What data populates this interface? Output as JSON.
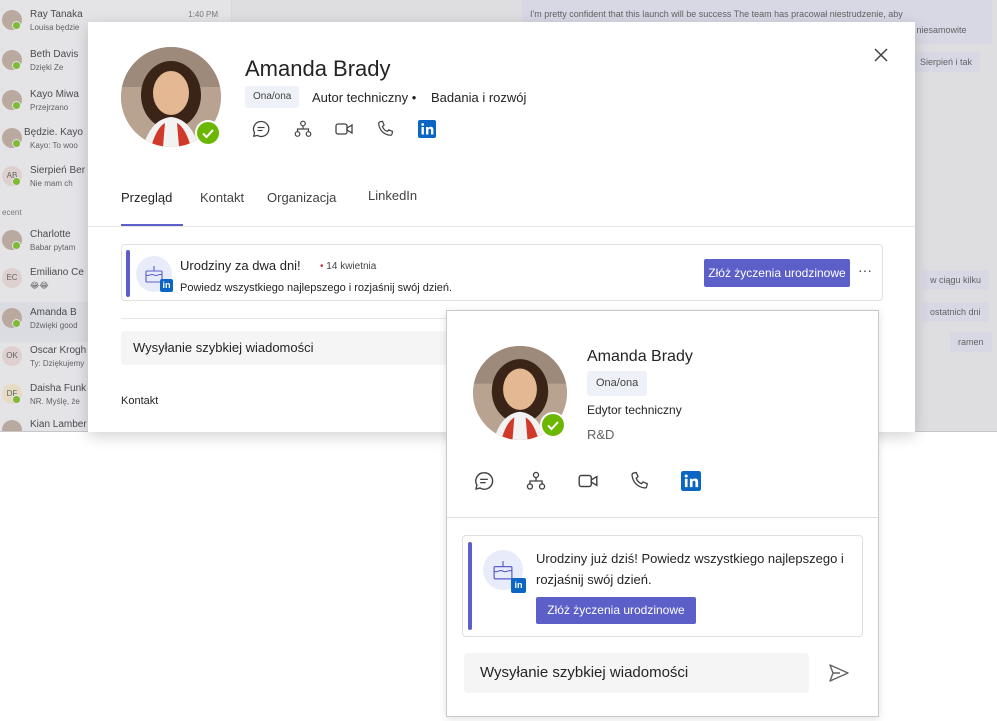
{
  "background": {
    "chat_list": [
      {
        "name": "Ray Tanaka",
        "preview": "Louisa będzie",
        "time": "1:40 PM",
        "avatar": ""
      },
      {
        "name": "Beth Davis",
        "preview": "Dzięki Ze",
        "time": "",
        "avatar": ""
      },
      {
        "name": "Kayo Miwa",
        "preview": "Przejrzano",
        "time": "",
        "avatar": ""
      },
      {
        "name": "Będzie. Kayo",
        "preview": "Kayo: To woo",
        "time": "",
        "avatar": ""
      },
      {
        "name": "Sierpień Ber",
        "preview": "Nie mam ch",
        "time": "",
        "avatar": "AB"
      },
      {
        "name": "Charlotte",
        "preview": "Babar pytam",
        "time": "",
        "avatar": ""
      },
      {
        "name": "Emiliano Ce",
        "preview": "😂😂",
        "time": "",
        "avatar": "EC"
      },
      {
        "name": "Amanda B",
        "preview": "Dźwięki good",
        "time": "",
        "avatar": ""
      },
      {
        "name": "Oscar Krogh",
        "preview": "Ty: Dziękujemy",
        "time": "",
        "avatar": "OK"
      },
      {
        "name": "Daisha Funk",
        "preview": "NR. Myślę, że",
        "time": "",
        "avatar": "DF"
      },
      {
        "name": "Kian Lamber",
        "preview": "",
        "time": "",
        "avatar": ""
      }
    ],
    "section_label": "ecent",
    "bubbles": [
      "I'm pretty confident that this launch will be success  The team has pracował niestrudzenie, aby",
      "być niesamowite",
      "Sierpień i tak",
      "w ciągu kilku",
      "ostatnich dni",
      "ramen"
    ]
  },
  "dialog": {
    "name": "Amanda Brady",
    "pronouns": "Ona/ona",
    "job_title": "Autor techniczny •",
    "department": "Badania i rozwój",
    "tabs": [
      "Przegląd",
      "Kontakt",
      "Organizacja",
      "LinkedIn"
    ],
    "active_tab": "Przegląd",
    "birthday": {
      "title": "Urodziny za dwa dni!",
      "date": "14 kwietnia",
      "subtitle": "Powiedz wszystkiego najlepszego i rozjaśnij swój dzień.",
      "button": "Złóż życzenia urodzinowe",
      "more": "···"
    },
    "quick_message_placeholder": "Wysyłanie szybkiej wiadomości",
    "contact_section": "Kontakt",
    "close": "×"
  },
  "card": {
    "name": "Amanda Brady",
    "pronouns": "Ona/ona",
    "job_title": "Edytor techniczny",
    "department": "R&D",
    "birthday": {
      "text": "Urodziny już dziś! Powiedz wszystkiego najlepszego i rozjaśnij swój dzień.",
      "button": "Złóż życzenia urodzinowe"
    },
    "quick_message_placeholder": "Wysyłanie szybkiej wiadomości"
  },
  "colors": {
    "accent": "#5b5fc7",
    "presence": "#6bb700",
    "linkedin": "#0a66c2"
  },
  "icons": [
    "chat-icon",
    "org-chart-icon",
    "video-call-icon",
    "phone-call-icon",
    "linkedin-icon",
    "send-icon",
    "close-icon",
    "birthday-icon"
  ]
}
